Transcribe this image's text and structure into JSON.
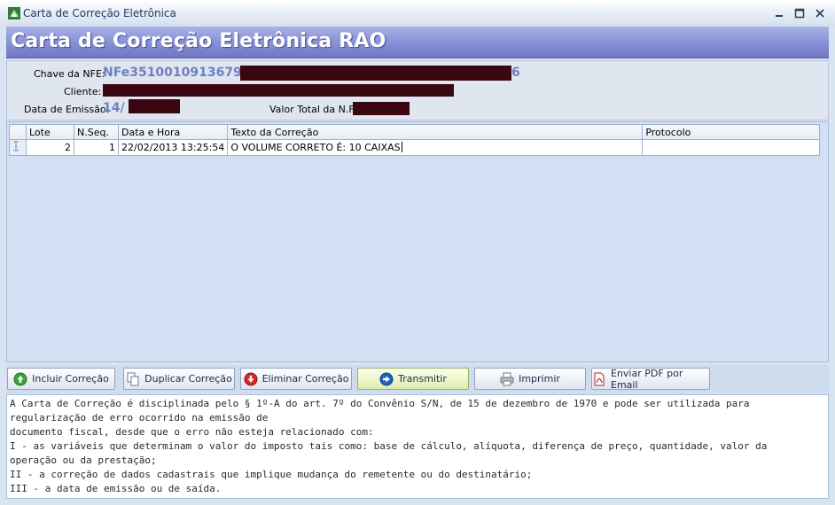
{
  "window": {
    "title": "Carta de Correção Eletrônica",
    "icon": "app-icon",
    "controls": [
      "minimize-icon",
      "maximize-icon",
      "close-icon"
    ]
  },
  "banner": {
    "title": "Carta de Correção Eletrônica RAO"
  },
  "info": {
    "chave_label": "Chave da NFE:",
    "chave_value_start": "NFe3510010913679",
    "chave_value_end": "6",
    "cliente_label": "Cliente:",
    "data_label": "Data de Emissão:",
    "data_value": "14/",
    "valor_label": "Valor Total da N.F."
  },
  "grid": {
    "columns": [
      "Lote",
      "N.Seq.",
      "Data e Hora",
      "Texto da Correção",
      "Protocolo"
    ],
    "rows": [
      {
        "lote": "2",
        "seq": "1",
        "datahora": "22/02/2013 13:25:54",
        "texto": "O VOLUME CORRETO É: 10 CAIXAS",
        "protocolo": ""
      }
    ]
  },
  "buttons": {
    "incluir": "Incluir Correção",
    "duplicar": "Duplicar Correção",
    "eliminar": "Eliminar Correção",
    "transmitir": "Transmitir",
    "imprimir": "Imprimir",
    "enviar": "Enviar PDF por Email"
  },
  "notes": {
    "lines": [
      "A Carta de Correção é disciplinada pelo § 1º-A do art. 7º do Convênio S/N, de 15 de dezembro de 1970 e pode ser utilizada para",
      "regularização de erro ocorrido na emissão de",
      "documento fiscal, desde que o erro não esteja relacionado com:",
      "I - as variáveis que determinam o valor do imposto tais como: base de cálculo, alíquota, diferença de preço, quantidade, valor da",
      "operação ou da prestação;",
      "II - a correção de dados cadastrais que implique mudança do remetente ou do destinatário;",
      "III - a data de emissão ou de saída."
    ]
  },
  "colors": {
    "banner": "#8b95d8",
    "info_value": "#6f7fc0",
    "redaction": "#3a0612"
  }
}
